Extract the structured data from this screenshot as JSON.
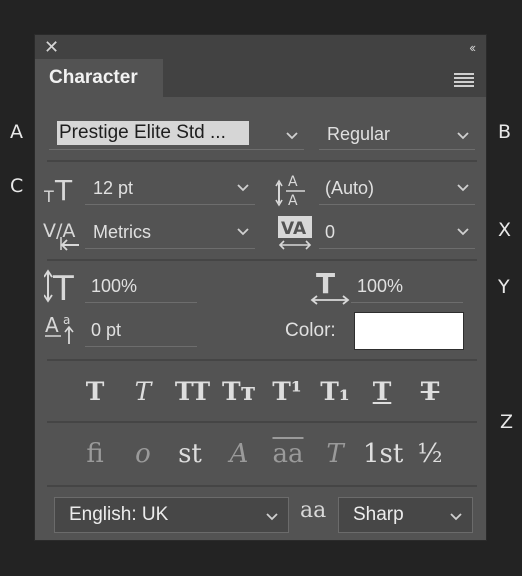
{
  "callouts": {
    "a": "A",
    "b": "B",
    "c": "C",
    "x": "X",
    "y": "Y",
    "z": "Z"
  },
  "panel": {
    "tab_title": "Character",
    "icons": [
      "close-icon",
      "collapse-icon",
      "panel-menu-icon"
    ]
  },
  "font_family": {
    "value": "Prestige Elite Std ..."
  },
  "font_style": {
    "value": "Regular"
  },
  "font_size": {
    "value": "12 pt"
  },
  "leading": {
    "value": "(Auto)"
  },
  "kerning": {
    "value": "Metrics"
  },
  "tracking": {
    "value": "0"
  },
  "vertical_scale": {
    "value": "100%"
  },
  "horizontal_scale": {
    "value": "100%"
  },
  "baseline_shift": {
    "value": "0 pt"
  },
  "color": {
    "label": "Color:",
    "value": "#ffffff"
  },
  "style_buttons": [
    {
      "name": "faux-bold",
      "glyph": "T"
    },
    {
      "name": "faux-italic",
      "glyph": "T"
    },
    {
      "name": "all-caps",
      "glyph": "TT"
    },
    {
      "name": "small-caps",
      "glyph": "Tт"
    },
    {
      "name": "superscript",
      "glyph": "T¹"
    },
    {
      "name": "subscript",
      "glyph": "T₁"
    },
    {
      "name": "underline",
      "glyph": "T"
    },
    {
      "name": "strikethrough",
      "glyph": "T"
    }
  ],
  "opentype_buttons": [
    {
      "name": "standard-ligatures",
      "glyph": "fi"
    },
    {
      "name": "contextual-alternates",
      "glyph": "o"
    },
    {
      "name": "discretionary-ligatures",
      "glyph": "st"
    },
    {
      "name": "swash",
      "glyph": "A"
    },
    {
      "name": "stylistic-alternates",
      "glyph": "aa"
    },
    {
      "name": "titling-alternates",
      "glyph": "T"
    },
    {
      "name": "ordinals",
      "glyph": "1st"
    },
    {
      "name": "fractions",
      "glyph": "½"
    }
  ],
  "language": {
    "value": "English: UK"
  },
  "antialias_icon_text": "aa",
  "antialias": {
    "value": "Sharp"
  }
}
